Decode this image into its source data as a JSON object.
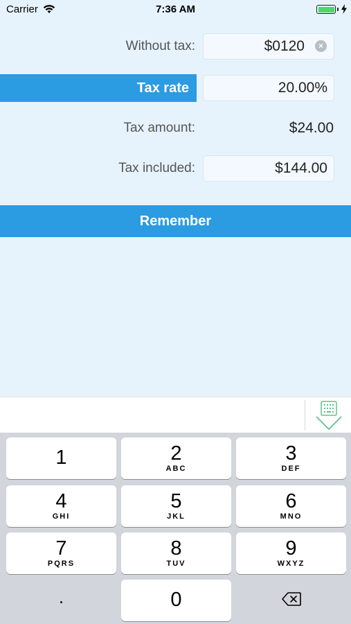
{
  "status_bar": {
    "carrier": "Carrier",
    "time": "7:36 AM",
    "battery_color": "#4cd964"
  },
  "form": {
    "without_tax": {
      "label": "Without tax:",
      "value": "$0120"
    },
    "tax_rate": {
      "label": "Tax rate",
      "value": "20.00%"
    },
    "tax_amount": {
      "label": "Tax amount:",
      "value": "$24.00"
    },
    "tax_included": {
      "label": "Tax included:",
      "value": "$144.00"
    }
  },
  "remember_label": "Remember",
  "keypad": {
    "keys": [
      {
        "digit": "1",
        "letters": ""
      },
      {
        "digit": "2",
        "letters": "ABC"
      },
      {
        "digit": "3",
        "letters": "DEF"
      },
      {
        "digit": "4",
        "letters": "GHI"
      },
      {
        "digit": "5",
        "letters": "JKL"
      },
      {
        "digit": "6",
        "letters": "MNO"
      },
      {
        "digit": "7",
        "letters": "PQRS"
      },
      {
        "digit": "8",
        "letters": "TUV"
      },
      {
        "digit": "9",
        "letters": "WXYZ"
      },
      {
        "digit": ".",
        "letters": ""
      },
      {
        "digit": "0",
        "letters": ""
      }
    ]
  },
  "colors": {
    "accent": "#2b9be2",
    "background": "#e6f3fd",
    "keyboard_bg": "#d2d5db"
  },
  "icons": {
    "wifi": "wifi-icon",
    "charging": "bolt-icon",
    "clear": "clear-icon",
    "dismiss_keyboard": "keyboard-dismiss-icon",
    "backspace": "backspace-icon"
  }
}
